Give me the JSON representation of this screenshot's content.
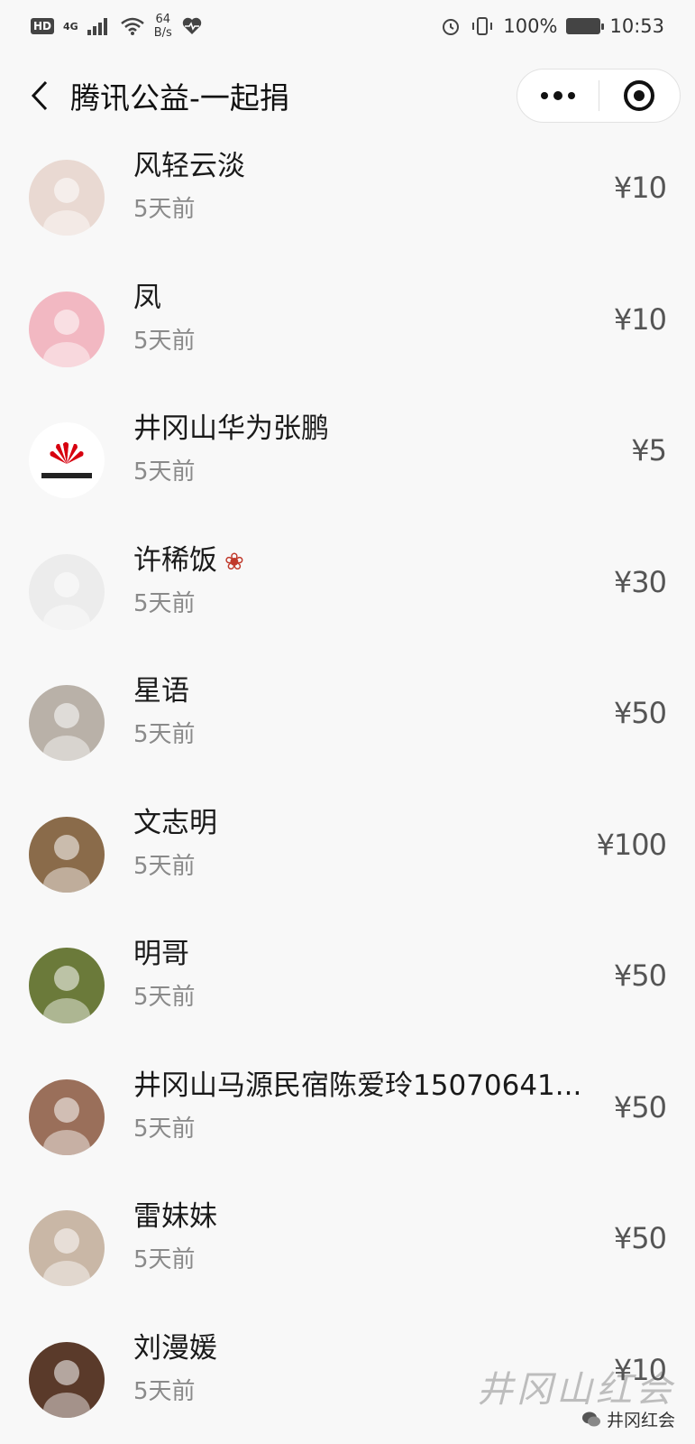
{
  "status_bar": {
    "hd": "HD",
    "network": "4G",
    "speed_value": "64",
    "speed_unit": "B/s",
    "battery": "100%",
    "time": "10:53"
  },
  "nav": {
    "title": "腾讯公益-一起捐"
  },
  "donors": [
    {
      "name": "风轻云淡",
      "time": "5天前",
      "amount": "¥10",
      "avatar_color": "#e9d9d2"
    },
    {
      "name": "凤",
      "time": "5天前",
      "amount": "¥10",
      "avatar_color": "#f2b8c2"
    },
    {
      "name": "井冈山华为张鹏",
      "time": "5天前",
      "amount": "¥5",
      "avatar_color": "#ffffff"
    },
    {
      "name": "许稀饭",
      "time": "5天前",
      "amount": "¥30",
      "avatar_color": "#ececec"
    },
    {
      "name": "星语",
      "time": "5天前",
      "amount": "¥50",
      "avatar_color": "#b9b1a8"
    },
    {
      "name": "文志明",
      "time": "5天前",
      "amount": "¥100",
      "avatar_color": "#8a6b4a"
    },
    {
      "name": "明哥",
      "time": "5天前",
      "amount": "¥50",
      "avatar_color": "#6b7a3a"
    },
    {
      "name": "井冈山马源民宿陈爱玲15070641...",
      "time": "5天前",
      "amount": "¥50",
      "avatar_color": "#9a6f5a"
    },
    {
      "name": "雷妹妹",
      "time": "5天前",
      "amount": "¥50",
      "avatar_color": "#c9b7a6"
    },
    {
      "name": "刘漫媛",
      "time": "5天前",
      "amount": "¥10",
      "avatar_color": "#5a3a2a"
    }
  ],
  "watermark": {
    "art_text": "井冈山红会",
    "badge_text": "井冈红会"
  }
}
